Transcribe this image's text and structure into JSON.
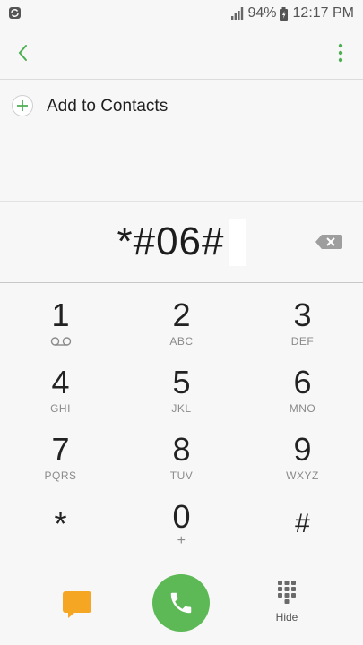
{
  "status_bar": {
    "battery_percent": "94%",
    "time": "12:17 PM",
    "icons": [
      "sync-icon",
      "signal-icon",
      "battery-icon"
    ]
  },
  "action_bar": {
    "back_icon": "chevron-left-icon",
    "more_icon": "more-vertical-icon",
    "accent_color": "#4caf50"
  },
  "contacts": {
    "add_label": "Add to Contacts"
  },
  "dialer": {
    "number": "*#06#",
    "backspace_icon": "backspace-icon"
  },
  "keypad": {
    "keys": [
      {
        "digit": "1",
        "letters": "",
        "icon": "voicemail-icon"
      },
      {
        "digit": "2",
        "letters": "ABC"
      },
      {
        "digit": "3",
        "letters": "DEF"
      },
      {
        "digit": "4",
        "letters": "GHI"
      },
      {
        "digit": "5",
        "letters": "JKL"
      },
      {
        "digit": "6",
        "letters": "MNO"
      },
      {
        "digit": "7",
        "letters": "PQRS"
      },
      {
        "digit": "8",
        "letters": "TUV"
      },
      {
        "digit": "9",
        "letters": "WXYZ"
      },
      {
        "digit": "*",
        "letters": ""
      },
      {
        "digit": "0",
        "letters": "+"
      },
      {
        "digit": "#",
        "letters": ""
      }
    ]
  },
  "bottom_bar": {
    "message_icon": "message-icon",
    "call_icon": "phone-icon",
    "call_color": "#5cb956",
    "hide_label": "Hide"
  }
}
